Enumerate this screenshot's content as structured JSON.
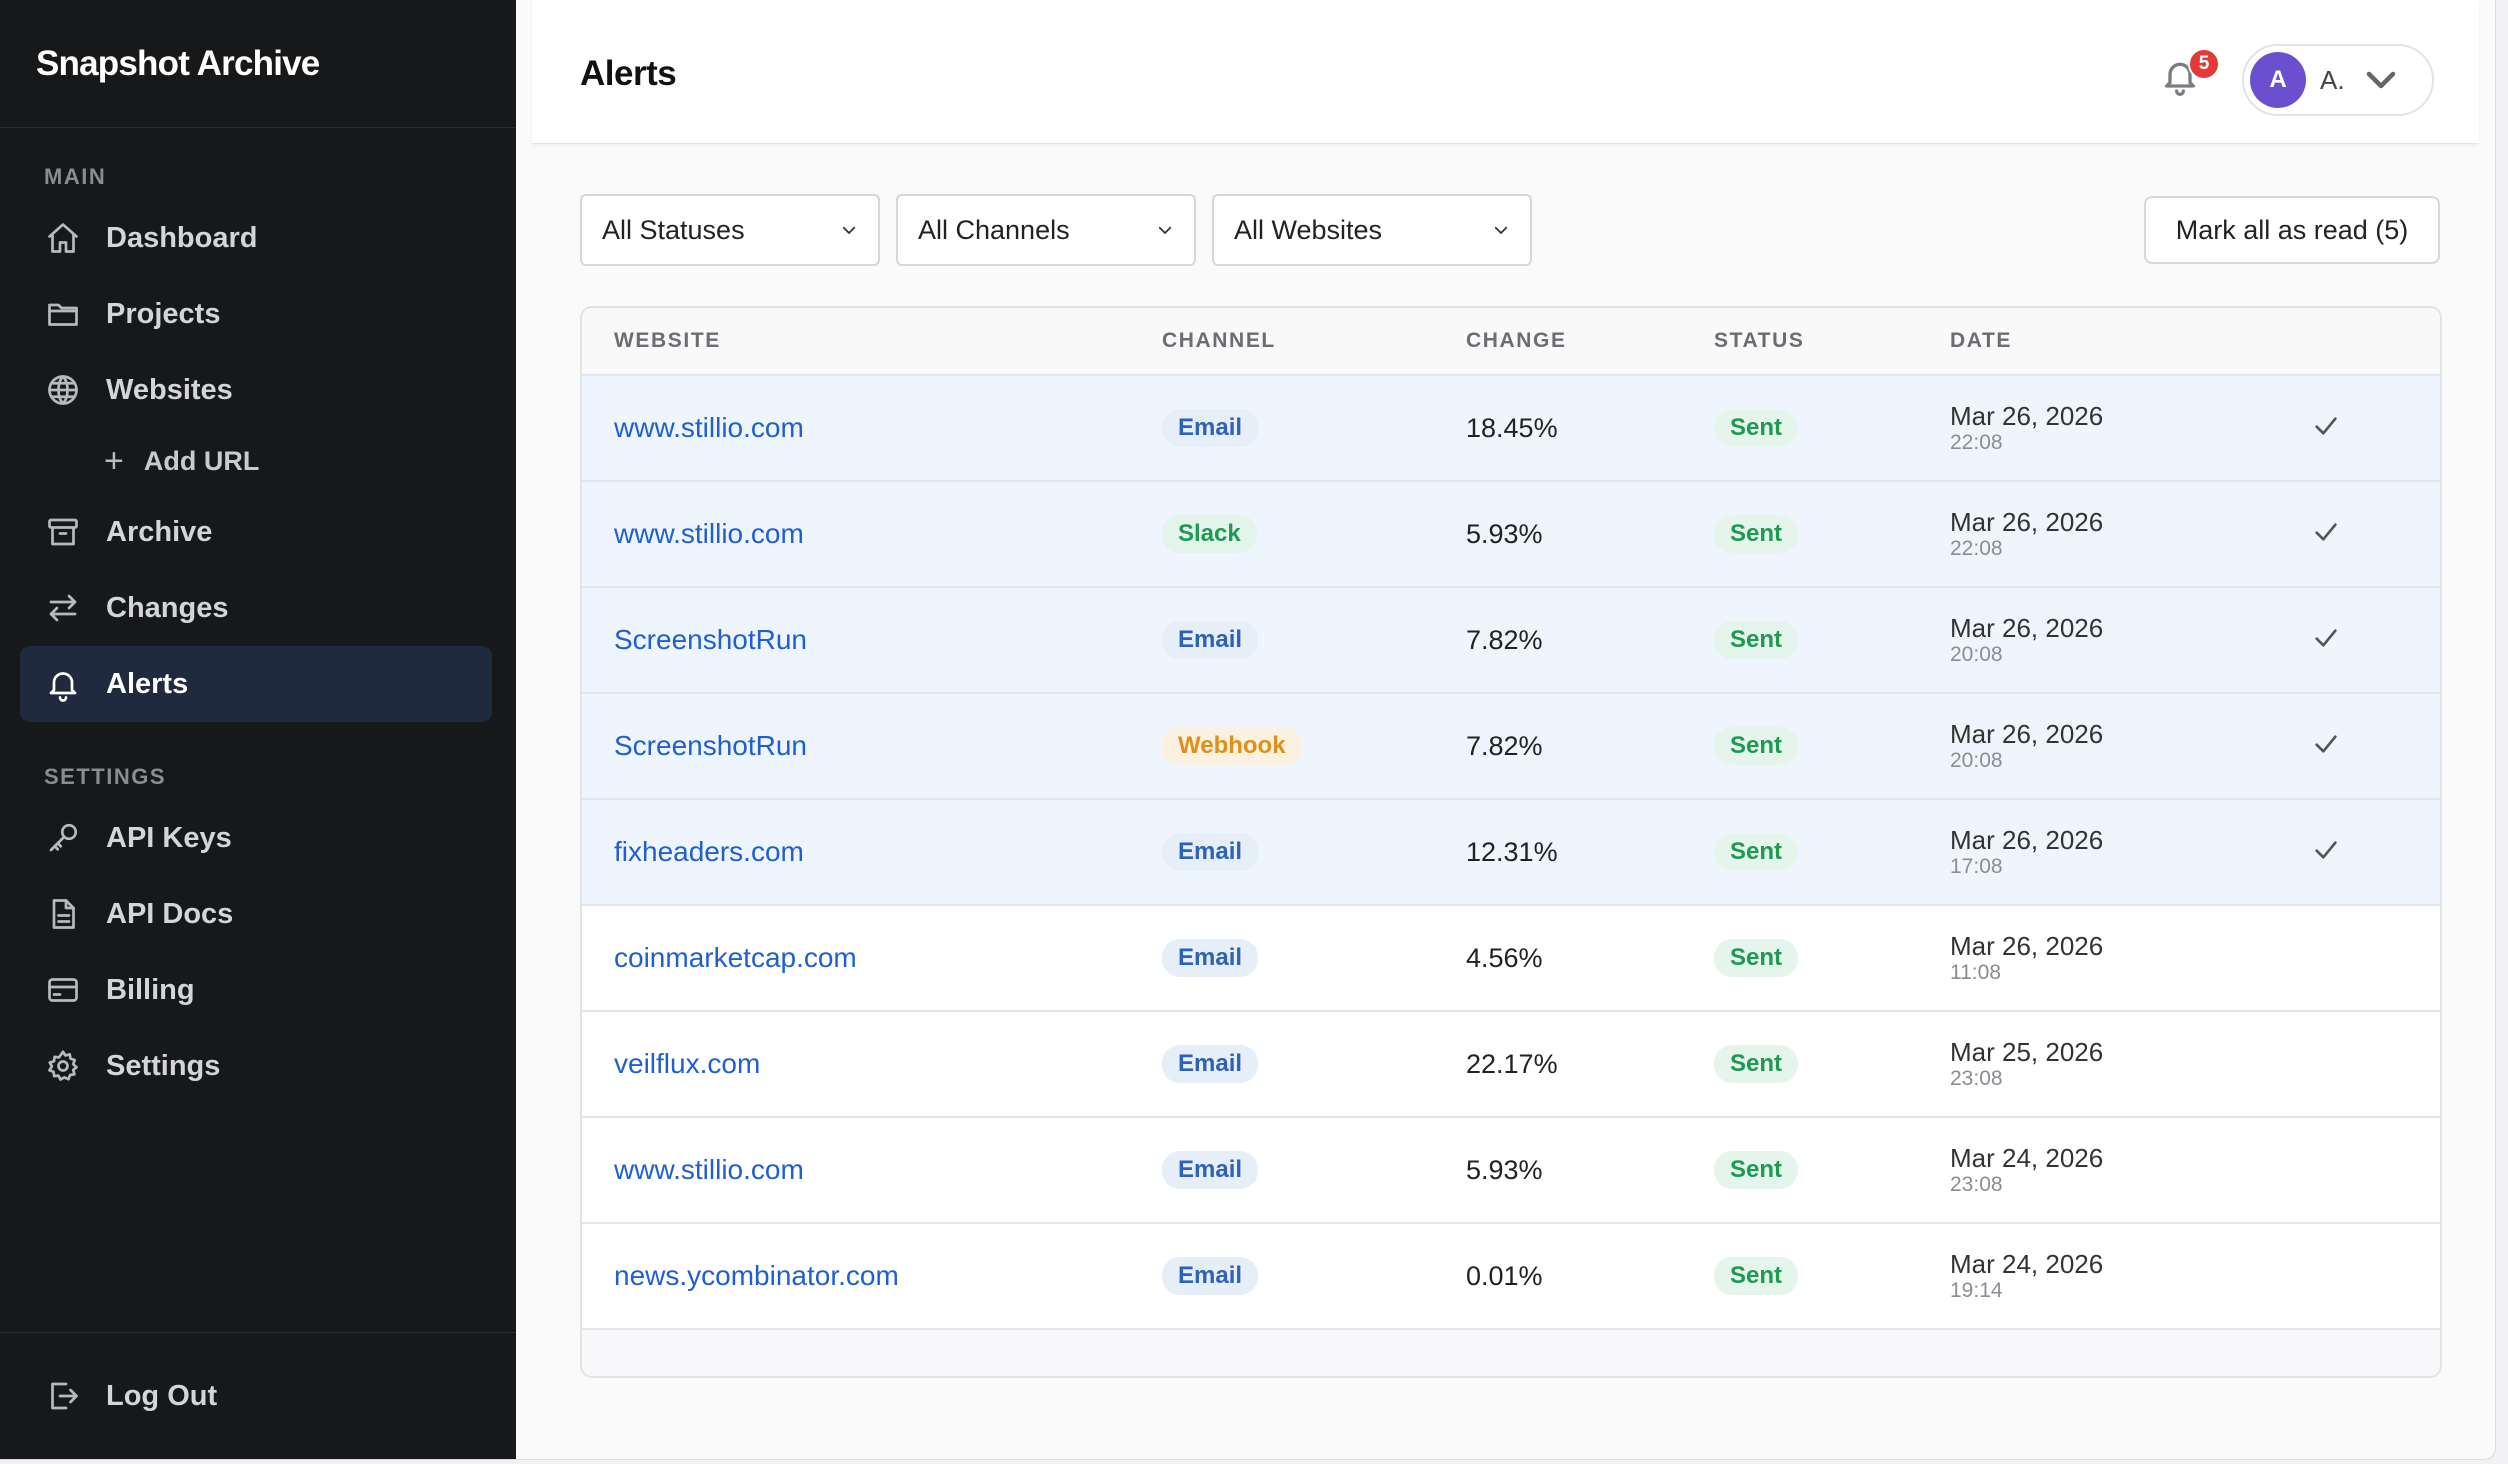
{
  "app": {
    "title": "Snapshot Archive"
  },
  "sidebar": {
    "main_label": "MAIN",
    "settings_label": "SETTINGS",
    "items": [
      {
        "label": "Dashboard",
        "icon": "home-icon"
      },
      {
        "label": "Projects",
        "icon": "folder-icon"
      },
      {
        "label": "Websites",
        "icon": "globe-icon"
      },
      {
        "label": "Add URL",
        "icon": "plus-icon"
      },
      {
        "label": "Archive",
        "icon": "archive-icon"
      },
      {
        "label": "Changes",
        "icon": "swap-arrows-icon"
      },
      {
        "label": "Alerts",
        "icon": "bell-icon",
        "active": true
      },
      {
        "label": "API Keys",
        "icon": "key-icon"
      },
      {
        "label": "API Docs",
        "icon": "document-icon"
      },
      {
        "label": "Billing",
        "icon": "credit-card-icon"
      },
      {
        "label": "Settings",
        "icon": "gear-icon"
      }
    ],
    "logout_label": "Log Out"
  },
  "header": {
    "title": "Alerts",
    "notification_count": "5",
    "user_initial": "A",
    "user_name": "A."
  },
  "filters": {
    "status": "All Statuses",
    "channel": "All Channels",
    "website": "All Websites",
    "mark_all_label": "Mark all as read (5)"
  },
  "table": {
    "columns": [
      "WEBSITE",
      "CHANNEL",
      "CHANGE",
      "STATUS",
      "DATE"
    ],
    "rows": [
      {
        "website": "www.stillio.com",
        "channel": "Email",
        "change": "18.45%",
        "status": "Sent",
        "date": "Mar 26, 2026",
        "time": "22:08",
        "unread": true
      },
      {
        "website": "www.stillio.com",
        "channel": "Slack",
        "change": "5.93%",
        "status": "Sent",
        "date": "Mar 26, 2026",
        "time": "22:08",
        "unread": true
      },
      {
        "website": "ScreenshotRun",
        "channel": "Email",
        "change": "7.82%",
        "status": "Sent",
        "date": "Mar 26, 2026",
        "time": "20:08",
        "unread": true
      },
      {
        "website": "ScreenshotRun",
        "channel": "Webhook",
        "change": "7.82%",
        "status": "Sent",
        "date": "Mar 26, 2026",
        "time": "20:08",
        "unread": true
      },
      {
        "website": "fixheaders.com",
        "channel": "Email",
        "change": "12.31%",
        "status": "Sent",
        "date": "Mar 26, 2026",
        "time": "17:08",
        "unread": true
      },
      {
        "website": "coinmarketcap.com",
        "channel": "Email",
        "change": "4.56%",
        "status": "Sent",
        "date": "Mar 26, 2026",
        "time": "11:08",
        "unread": false
      },
      {
        "website": "veilflux.com",
        "channel": "Email",
        "change": "22.17%",
        "status": "Sent",
        "date": "Mar 25, 2026",
        "time": "23:08",
        "unread": false
      },
      {
        "website": "www.stillio.com",
        "channel": "Email",
        "change": "5.93%",
        "status": "Sent",
        "date": "Mar 24, 2026",
        "time": "23:08",
        "unread": false
      },
      {
        "website": "news.ycombinator.com",
        "channel": "Email",
        "change": "0.01%",
        "status": "Sent",
        "date": "Mar 24, 2026",
        "time": "19:14",
        "unread": false
      }
    ]
  },
  "colors": {
    "sidebar_bg": "#17181a",
    "active_nav_bg": "#1f2a3f",
    "link": "#1f5fd1",
    "unread_row_bg": "#eef5fc",
    "badge_red": "#e53935",
    "avatar": "#6a4fcf"
  }
}
